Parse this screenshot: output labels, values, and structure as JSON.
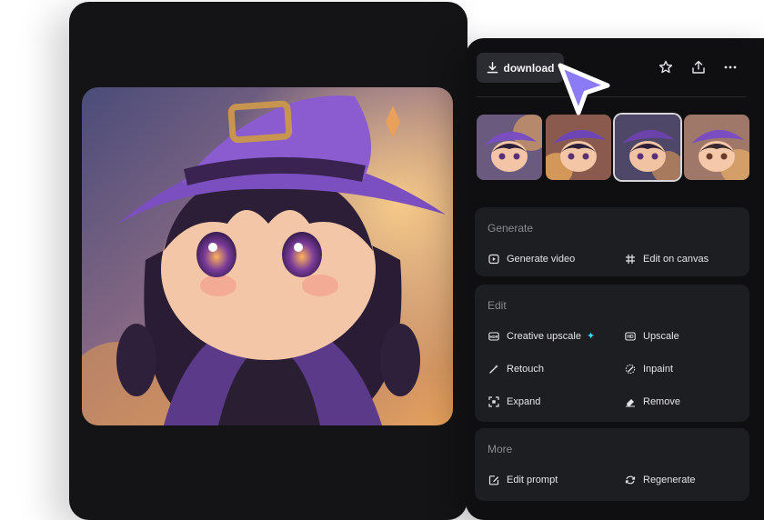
{
  "toolbar": {
    "download_label": "download",
    "icons": [
      "star-icon",
      "share-icon",
      "more-icon"
    ]
  },
  "thumbnails": [
    {
      "name": "variation-1",
      "selected": false
    },
    {
      "name": "variation-2",
      "selected": false
    },
    {
      "name": "variation-3",
      "selected": true
    },
    {
      "name": "variation-4",
      "selected": false
    }
  ],
  "sections": {
    "generate": {
      "title": "Generate",
      "items": [
        {
          "label": "Generate video",
          "icon": "play-icon"
        },
        {
          "label": "Edit on canvas",
          "icon": "grid-icon"
        }
      ]
    },
    "edit": {
      "title": "Edit",
      "items": [
        {
          "label": "Creative upscale",
          "icon": "hdr-icon",
          "badge": "sparkle-icon"
        },
        {
          "label": "Upscale",
          "icon": "hd-icon"
        },
        {
          "label": "Retouch",
          "icon": "magic-wand-icon"
        },
        {
          "label": "Inpaint",
          "icon": "inpaint-icon"
        },
        {
          "label": "Expand",
          "icon": "expand-icon"
        },
        {
          "label": "Remove",
          "icon": "eraser-icon"
        }
      ]
    },
    "more": {
      "title": "More",
      "items": [
        {
          "label": "Edit prompt",
          "icon": "edit-prompt-icon"
        },
        {
          "label": "Regenerate",
          "icon": "regenerate-icon"
        }
      ]
    }
  },
  "colors": {
    "accent_cursor": "#8b7cf6",
    "sparkle": "#3fd3f2",
    "panel_bg": "#0f0f11",
    "card_bg": "#1d1e22"
  }
}
